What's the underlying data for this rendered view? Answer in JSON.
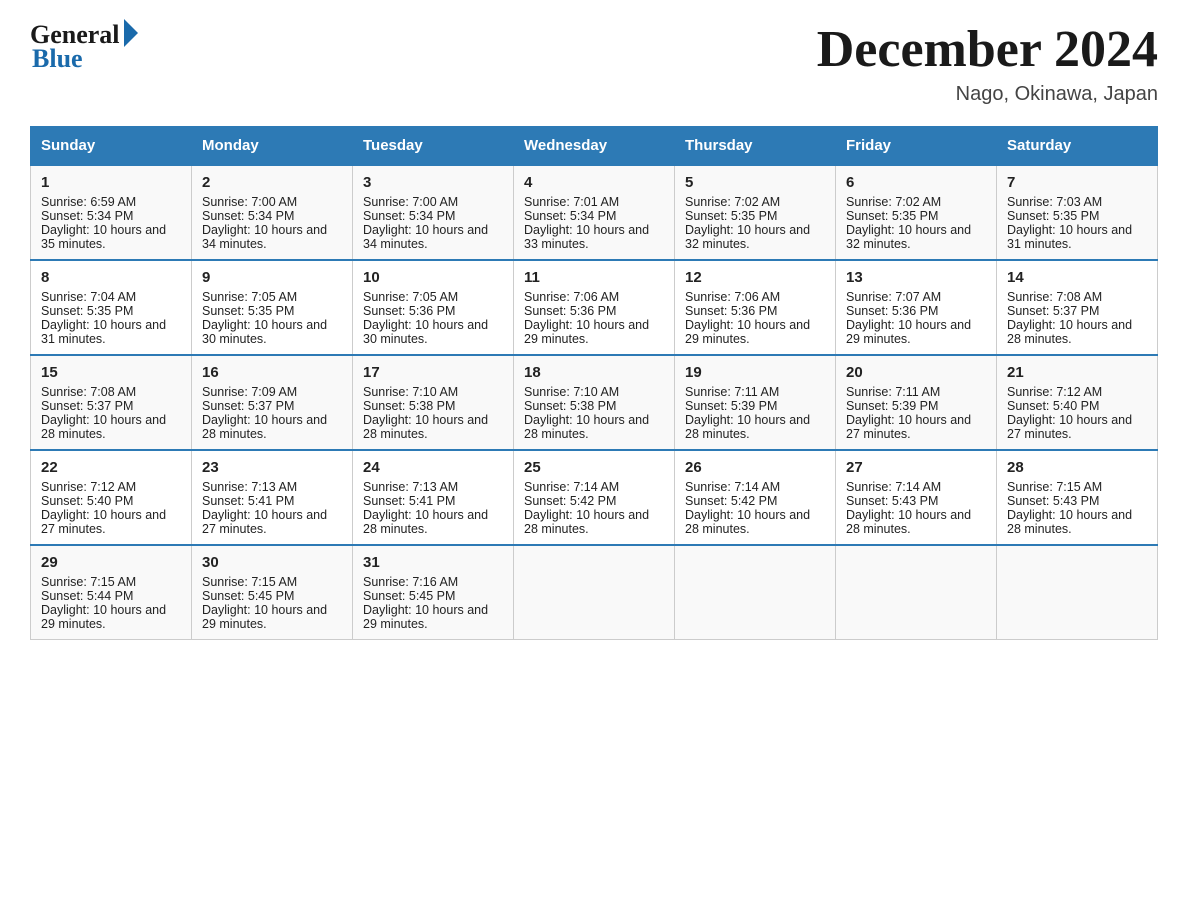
{
  "header": {
    "title": "December 2024",
    "location": "Nago, Okinawa, Japan",
    "logo_general": "General",
    "logo_blue": "Blue"
  },
  "columns": [
    "Sunday",
    "Monday",
    "Tuesday",
    "Wednesday",
    "Thursday",
    "Friday",
    "Saturday"
  ],
  "weeks": [
    [
      {
        "day": "1",
        "sunrise": "Sunrise: 6:59 AM",
        "sunset": "Sunset: 5:34 PM",
        "daylight": "Daylight: 10 hours and 35 minutes."
      },
      {
        "day": "2",
        "sunrise": "Sunrise: 7:00 AM",
        "sunset": "Sunset: 5:34 PM",
        "daylight": "Daylight: 10 hours and 34 minutes."
      },
      {
        "day": "3",
        "sunrise": "Sunrise: 7:00 AM",
        "sunset": "Sunset: 5:34 PM",
        "daylight": "Daylight: 10 hours and 34 minutes."
      },
      {
        "day": "4",
        "sunrise": "Sunrise: 7:01 AM",
        "sunset": "Sunset: 5:34 PM",
        "daylight": "Daylight: 10 hours and 33 minutes."
      },
      {
        "day": "5",
        "sunrise": "Sunrise: 7:02 AM",
        "sunset": "Sunset: 5:35 PM",
        "daylight": "Daylight: 10 hours and 32 minutes."
      },
      {
        "day": "6",
        "sunrise": "Sunrise: 7:02 AM",
        "sunset": "Sunset: 5:35 PM",
        "daylight": "Daylight: 10 hours and 32 minutes."
      },
      {
        "day": "7",
        "sunrise": "Sunrise: 7:03 AM",
        "sunset": "Sunset: 5:35 PM",
        "daylight": "Daylight: 10 hours and 31 minutes."
      }
    ],
    [
      {
        "day": "8",
        "sunrise": "Sunrise: 7:04 AM",
        "sunset": "Sunset: 5:35 PM",
        "daylight": "Daylight: 10 hours and 31 minutes."
      },
      {
        "day": "9",
        "sunrise": "Sunrise: 7:05 AM",
        "sunset": "Sunset: 5:35 PM",
        "daylight": "Daylight: 10 hours and 30 minutes."
      },
      {
        "day": "10",
        "sunrise": "Sunrise: 7:05 AM",
        "sunset": "Sunset: 5:36 PM",
        "daylight": "Daylight: 10 hours and 30 minutes."
      },
      {
        "day": "11",
        "sunrise": "Sunrise: 7:06 AM",
        "sunset": "Sunset: 5:36 PM",
        "daylight": "Daylight: 10 hours and 29 minutes."
      },
      {
        "day": "12",
        "sunrise": "Sunrise: 7:06 AM",
        "sunset": "Sunset: 5:36 PM",
        "daylight": "Daylight: 10 hours and 29 minutes."
      },
      {
        "day": "13",
        "sunrise": "Sunrise: 7:07 AM",
        "sunset": "Sunset: 5:36 PM",
        "daylight": "Daylight: 10 hours and 29 minutes."
      },
      {
        "day": "14",
        "sunrise": "Sunrise: 7:08 AM",
        "sunset": "Sunset: 5:37 PM",
        "daylight": "Daylight: 10 hours and 28 minutes."
      }
    ],
    [
      {
        "day": "15",
        "sunrise": "Sunrise: 7:08 AM",
        "sunset": "Sunset: 5:37 PM",
        "daylight": "Daylight: 10 hours and 28 minutes."
      },
      {
        "day": "16",
        "sunrise": "Sunrise: 7:09 AM",
        "sunset": "Sunset: 5:37 PM",
        "daylight": "Daylight: 10 hours and 28 minutes."
      },
      {
        "day": "17",
        "sunrise": "Sunrise: 7:10 AM",
        "sunset": "Sunset: 5:38 PM",
        "daylight": "Daylight: 10 hours and 28 minutes."
      },
      {
        "day": "18",
        "sunrise": "Sunrise: 7:10 AM",
        "sunset": "Sunset: 5:38 PM",
        "daylight": "Daylight: 10 hours and 28 minutes."
      },
      {
        "day": "19",
        "sunrise": "Sunrise: 7:11 AM",
        "sunset": "Sunset: 5:39 PM",
        "daylight": "Daylight: 10 hours and 28 minutes."
      },
      {
        "day": "20",
        "sunrise": "Sunrise: 7:11 AM",
        "sunset": "Sunset: 5:39 PM",
        "daylight": "Daylight: 10 hours and 27 minutes."
      },
      {
        "day": "21",
        "sunrise": "Sunrise: 7:12 AM",
        "sunset": "Sunset: 5:40 PM",
        "daylight": "Daylight: 10 hours and 27 minutes."
      }
    ],
    [
      {
        "day": "22",
        "sunrise": "Sunrise: 7:12 AM",
        "sunset": "Sunset: 5:40 PM",
        "daylight": "Daylight: 10 hours and 27 minutes."
      },
      {
        "day": "23",
        "sunrise": "Sunrise: 7:13 AM",
        "sunset": "Sunset: 5:41 PM",
        "daylight": "Daylight: 10 hours and 27 minutes."
      },
      {
        "day": "24",
        "sunrise": "Sunrise: 7:13 AM",
        "sunset": "Sunset: 5:41 PM",
        "daylight": "Daylight: 10 hours and 28 minutes."
      },
      {
        "day": "25",
        "sunrise": "Sunrise: 7:14 AM",
        "sunset": "Sunset: 5:42 PM",
        "daylight": "Daylight: 10 hours and 28 minutes."
      },
      {
        "day": "26",
        "sunrise": "Sunrise: 7:14 AM",
        "sunset": "Sunset: 5:42 PM",
        "daylight": "Daylight: 10 hours and 28 minutes."
      },
      {
        "day": "27",
        "sunrise": "Sunrise: 7:14 AM",
        "sunset": "Sunset: 5:43 PM",
        "daylight": "Daylight: 10 hours and 28 minutes."
      },
      {
        "day": "28",
        "sunrise": "Sunrise: 7:15 AM",
        "sunset": "Sunset: 5:43 PM",
        "daylight": "Daylight: 10 hours and 28 minutes."
      }
    ],
    [
      {
        "day": "29",
        "sunrise": "Sunrise: 7:15 AM",
        "sunset": "Sunset: 5:44 PM",
        "daylight": "Daylight: 10 hours and 29 minutes."
      },
      {
        "day": "30",
        "sunrise": "Sunrise: 7:15 AM",
        "sunset": "Sunset: 5:45 PM",
        "daylight": "Daylight: 10 hours and 29 minutes."
      },
      {
        "day": "31",
        "sunrise": "Sunrise: 7:16 AM",
        "sunset": "Sunset: 5:45 PM",
        "daylight": "Daylight: 10 hours and 29 minutes."
      },
      {
        "day": "",
        "sunrise": "",
        "sunset": "",
        "daylight": ""
      },
      {
        "day": "",
        "sunrise": "",
        "sunset": "",
        "daylight": ""
      },
      {
        "day": "",
        "sunrise": "",
        "sunset": "",
        "daylight": ""
      },
      {
        "day": "",
        "sunrise": "",
        "sunset": "",
        "daylight": ""
      }
    ]
  ]
}
